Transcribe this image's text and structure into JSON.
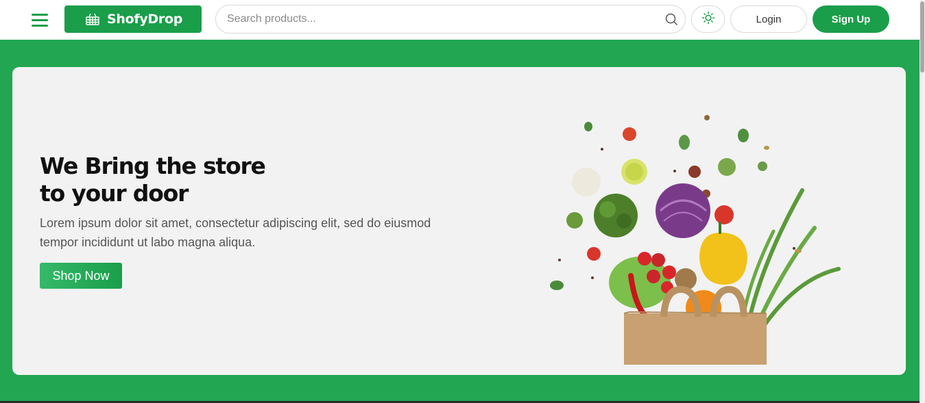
{
  "header": {
    "brand": "ShofyDrop",
    "search_placeholder": "Search products...",
    "login_label": "Login",
    "signup_label": "Sign Up",
    "icons": [
      "menu-icon",
      "basket-icon",
      "search-icon",
      "sun-icon"
    ]
  },
  "hero": {
    "title_line1": "We Bring the store",
    "title_line2": "to your door",
    "description": "Lorem ipsum dolor sit amet, consectetur adipiscing elit, sed do eiusmod tempor incididunt ut labo magna aliqua.",
    "cta_label": "Shop Now",
    "image": "grocery-bag-with-vegetables"
  },
  "colors": {
    "brand_green": "#1a9e4a",
    "band_green": "#22a651",
    "card_bg": "#f2f2f2"
  }
}
